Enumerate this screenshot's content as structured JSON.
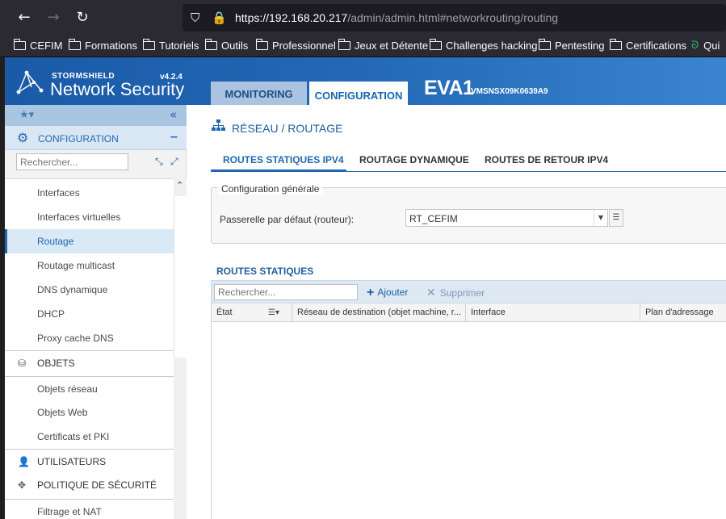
{
  "browser": {
    "url_host": "https://192.168.20.217",
    "url_path": "/admin/admin.html#networkrouting/routing",
    "bookmarks": [
      {
        "label": "CEFIM"
      },
      {
        "label": "Formations"
      },
      {
        "label": "Tutoriels"
      },
      {
        "label": "Outils"
      },
      {
        "label": "Professionnel"
      },
      {
        "label": "Jeux et Détente"
      },
      {
        "label": "Challenges hacking"
      },
      {
        "label": "Pentesting"
      },
      {
        "label": "Certifications"
      },
      {
        "label": "Qui"
      }
    ]
  },
  "header": {
    "brand": "STORMSHIELD",
    "product": "Network Security",
    "version": "v4.2.4",
    "tab_monitoring": "MONITORING",
    "tab_configuration": "CONFIGURATION",
    "firewall_name": "EVA1",
    "firewall_serial": "VMSNSX09K0639A9"
  },
  "sidebar": {
    "config_label": "CONFIGURATION",
    "search_placeholder": "Rechercher...",
    "items": [
      {
        "label": "Interfaces"
      },
      {
        "label": "Interfaces virtuelles"
      },
      {
        "label": "Routage"
      },
      {
        "label": "Routage multicast"
      },
      {
        "label": "DNS dynamique"
      },
      {
        "label": "DHCP"
      },
      {
        "label": "Proxy cache DNS"
      }
    ],
    "section_objets": "OBJETS",
    "objets_items": [
      {
        "label": "Objets réseau"
      },
      {
        "label": "Objets Web"
      },
      {
        "label": "Certificats et PKI"
      }
    ],
    "section_users": "UTILISATEURS",
    "section_policy": "POLITIQUE DE SÉCURITÉ",
    "policy_items": [
      {
        "label": "Filtrage et NAT"
      }
    ]
  },
  "main": {
    "title": "RÉSEAU / ROUTAGE",
    "tabs": [
      {
        "label": "ROUTES STATIQUES IPV4"
      },
      {
        "label": "ROUTAGE DYNAMIQUE"
      },
      {
        "label": "ROUTES DE RETOUR IPV4"
      }
    ],
    "general_legend": "Configuration générale",
    "gateway_label": "Passerelle par défaut (routeur):",
    "gateway_value": "RT_CEFIM",
    "static_routes_title": "ROUTES STATIQUES",
    "search_placeholder": "Rechercher...",
    "add_label": "Ajouter",
    "delete_label": "Supprimer",
    "columns": [
      {
        "label": "État"
      },
      {
        "label": "Réseau de destination (objet machine, r..."
      },
      {
        "label": "Interface"
      },
      {
        "label": "Plan d'adressage"
      }
    ]
  },
  "colors": {
    "header_blue": "#1a5aa7",
    "accent_blue": "#1f68b1",
    "selected_bg": "#d9e9f6"
  }
}
